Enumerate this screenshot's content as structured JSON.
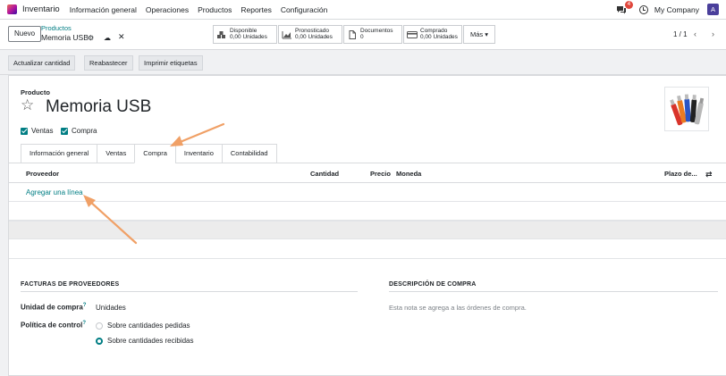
{
  "navbar": {
    "app_name": "Inventario",
    "menu": [
      "Información general",
      "Operaciones",
      "Productos",
      "Reportes",
      "Configuración"
    ],
    "notifications": "4",
    "company": "My Company",
    "avatar_letter": "A"
  },
  "control": {
    "new_button": "Nuevo",
    "breadcrumb": "Productos",
    "record_title": "Memoria USB",
    "smart_buttons": [
      {
        "icon": "cubes-icon",
        "label": "Disponible",
        "value": "0,00 Unidades"
      },
      {
        "icon": "chart-area-icon",
        "label": "Pronosticado",
        "value": "0,00 Unidades"
      },
      {
        "icon": "document-icon",
        "label": "Documentos",
        "value": "0"
      },
      {
        "icon": "credit-card-icon",
        "label": "Comprado",
        "value": "0,00 Unidades"
      }
    ],
    "more_button": "Más",
    "pager": "1 / 1"
  },
  "actions": [
    "Actualizar cantidad",
    "Reabastecer",
    "Imprimir etiquetas"
  ],
  "form": {
    "product_label": "Producto",
    "product_name": "Memoria USB",
    "checkboxes": [
      {
        "label": "Ventas",
        "checked": true
      },
      {
        "label": "Compra",
        "checked": true
      }
    ],
    "tabs": [
      "Información general",
      "Ventas",
      "Compra",
      "Inventario",
      "Contabilidad"
    ],
    "active_tab": "Compra",
    "table": {
      "columns": [
        "Proveedor",
        "Cantidad",
        "Precio",
        "Moneda",
        "Plazo de..."
      ],
      "add_line": "Agregar una línea"
    },
    "vendor_bills": {
      "title": "FACTURAS DE PROVEEDORES",
      "purchase_unit_label": "Unidad de compra",
      "purchase_unit_value": "Unidades",
      "control_policy_label": "Política de control",
      "options": [
        "Sobre cantidades pedidas",
        "Sobre cantidades recibidas"
      ],
      "selected": "Sobre cantidades recibidas"
    },
    "purchase_description": {
      "title": "DESCRIPCIÓN DE COMPRA",
      "placeholder": "Esta nota se agrega a las órdenes de compra."
    }
  },
  "colors": {
    "accent": "#017e84",
    "arrow": "#f0a066",
    "badge": "#e0473c"
  }
}
